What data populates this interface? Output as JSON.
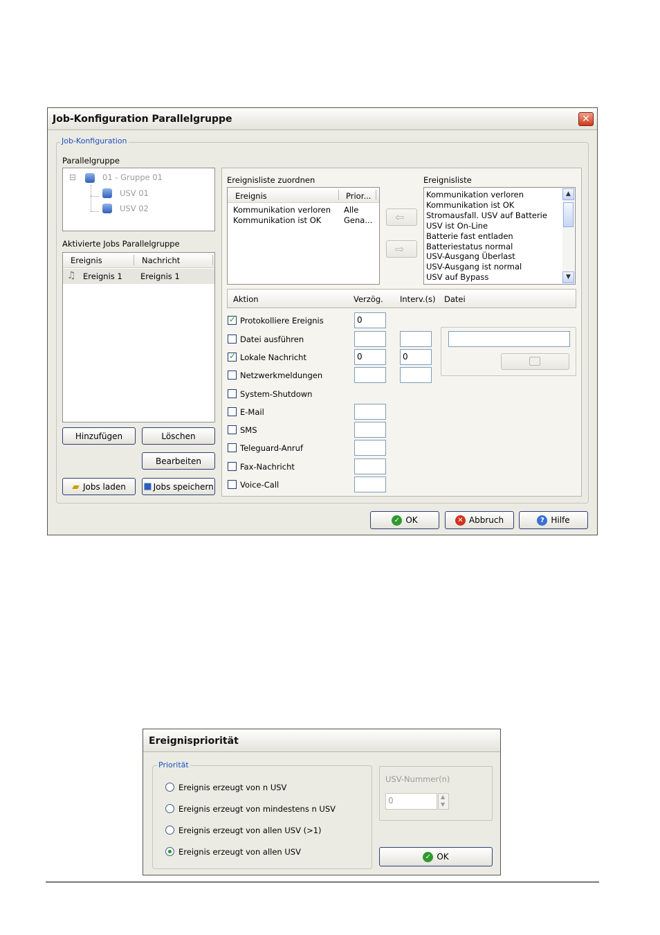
{
  "dialog1": {
    "title": "Job-Konfiguration Parallelgruppe",
    "close_label": "✕",
    "group_title": "Job-Konfiguration",
    "parallelgruppe_label": "Parallelgruppe",
    "tree": {
      "root": "01 - Gruppe 01",
      "children": [
        "USV 01",
        "USV 02"
      ],
      "collapse_symbol": "⊟"
    },
    "aktivierte_jobs_label": "Aktivierte Jobs Parallelgruppe",
    "jobs_table": {
      "headers": [
        "Ereignis",
        "Nachricht"
      ],
      "rows": [
        {
          "ereignis": "Ereignis 1",
          "nachricht": "Ereignis 1"
        }
      ]
    },
    "buttons": {
      "hinzufuegen": "Hinzufügen",
      "loeschen": "Löschen",
      "bearbeiten": "Bearbeiten",
      "jobs_laden": "Jobs laden",
      "jobs_speichern": "Jobs speichern"
    },
    "ereignisliste_zuordnen_label": "Ereignisliste zuordnen",
    "assigned_table": {
      "headers": [
        "Ereignis",
        "Prior..."
      ],
      "rows": [
        {
          "ereignis": "Kommunikation verloren",
          "prior": "Alle"
        },
        {
          "ereignis": "Kommunikation ist OK",
          "prior": "Gena..."
        }
      ]
    },
    "arrow_left": "⇦",
    "arrow_right": "⇨",
    "ereignisliste_label": "Ereignisliste",
    "ereignisliste": [
      "Kommunikation verloren",
      "Kommunikation ist OK",
      "Stromausfall. USV auf Batterie",
      "USV ist On-Line",
      "Batterie fast entladen",
      "Batteriestatus normal",
      "USV-Ausgang Überlast",
      "USV-Ausgang ist normal",
      "USV auf Bypass"
    ],
    "scroll_up": "▲",
    "scroll_down": "▼",
    "aktion_headers": {
      "aktion": "Aktion",
      "verzoeg": "Verzög.",
      "interv": "Interv.(s)",
      "datei": "Datei"
    },
    "aktionen": [
      {
        "label": "Protokolliere Ereignis",
        "checked": true,
        "verz": "0"
      },
      {
        "label": "Datei ausführen",
        "checked": false,
        "verz": "",
        "interv": ""
      },
      {
        "label": "Lokale Nachricht",
        "checked": true,
        "verz": "0",
        "interv": "0"
      },
      {
        "label": "Netzwerkmeldungen",
        "checked": false,
        "verz": "",
        "interv": ""
      },
      {
        "label": "System-Shutdown",
        "checked": false
      },
      {
        "label": "E-Mail",
        "checked": false,
        "verz": ""
      },
      {
        "label": "SMS",
        "checked": false,
        "verz": ""
      },
      {
        "label": "Teleguard-Anruf",
        "checked": false,
        "verz": ""
      },
      {
        "label": "Fax-Nachricht",
        "checked": false,
        "verz": ""
      },
      {
        "label": "Voice-Call",
        "checked": false,
        "verz": ""
      }
    ],
    "datei_value": "",
    "bottom_buttons": {
      "ok": "OK",
      "abbruch": "Abbruch",
      "hilfe": "Hilfe"
    }
  },
  "dialog2": {
    "title": "Ereignispriorität",
    "group_title": "Priorität",
    "options": [
      {
        "label": "Ereignis erzeugt von n USV",
        "selected": false
      },
      {
        "label": "Ereignis erzeugt von mindestens n USV",
        "selected": false
      },
      {
        "label": "Ereignis erzeugt von allen USV (>1)",
        "selected": false
      },
      {
        "label": "Ereignis erzeugt von allen USV",
        "selected": true
      }
    ],
    "usv_nummer_label": "USV-Nummer(n)",
    "usv_nummer_value": "0",
    "ok": "OK"
  }
}
